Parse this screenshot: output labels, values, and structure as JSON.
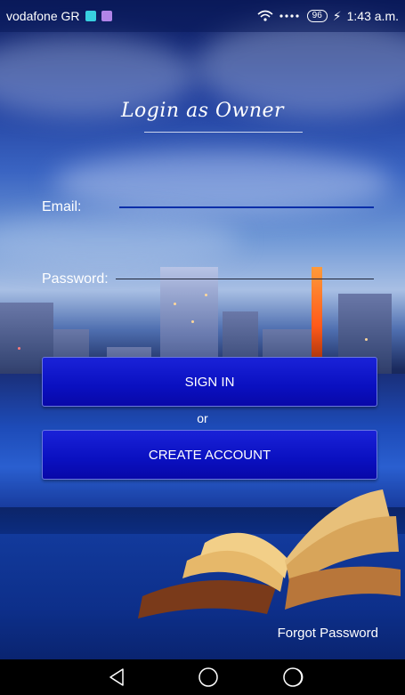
{
  "status_bar": {
    "carrier": "vodafone GR",
    "battery": "96",
    "time": "1:43 a.m.",
    "icons": [
      "notification-icon-1",
      "notification-icon-2",
      "wifi-icon",
      "signal-icon",
      "battery-icon",
      "charging-icon"
    ]
  },
  "screen": {
    "title": "Login as Owner"
  },
  "form": {
    "email_label": "Email:",
    "password_label": "Password:",
    "email_value": "",
    "password_value": ""
  },
  "buttons": {
    "sign_in": "SIGN IN",
    "or": "or",
    "create_account": "CREATE ACCOUNT",
    "forgot_password": "Forgot Password"
  },
  "nav_bar": {
    "icons": [
      "back-icon",
      "home-icon",
      "recent-apps-icon"
    ]
  },
  "colors": {
    "button_bg": "#0a10c0",
    "email_underline": "#0a2ea8",
    "text": "#ffffff"
  }
}
